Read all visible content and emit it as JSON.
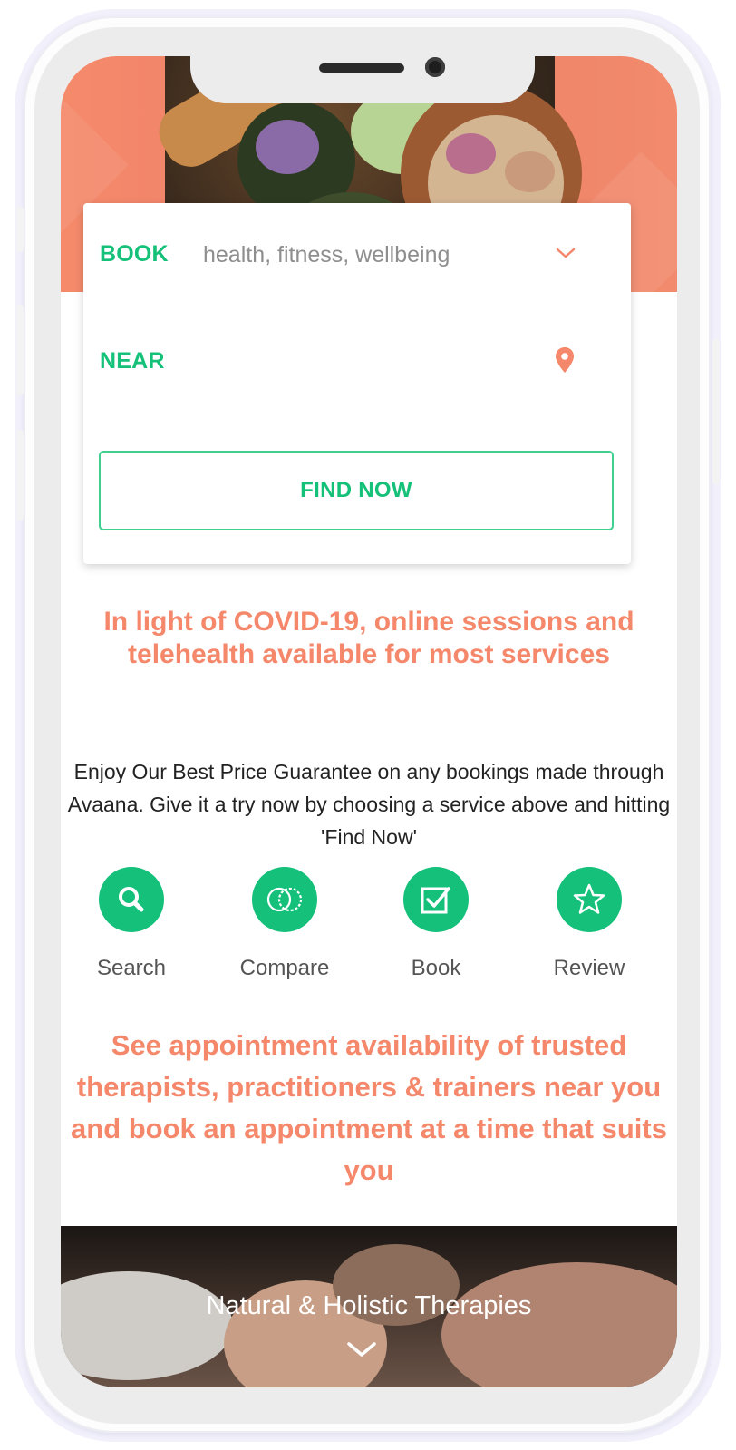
{
  "search": {
    "book_label": "BOOK",
    "book_placeholder": "health, fitness, wellbeing",
    "near_label": "NEAR",
    "near_value": "",
    "find_button": "FIND NOW"
  },
  "notice": "In light of COVID-19, online sessions and telehealth available for most services",
  "guarantee_text": "Enjoy Our Best Price Guarantee on any bookings made through Avaana. Give it a try now by choosing a service above and hitting 'Find Now'",
  "features": [
    {
      "label": "Search",
      "icon": "search-icon"
    },
    {
      "label": "Compare",
      "icon": "compare-icon"
    },
    {
      "label": "Book",
      "icon": "checkbox-icon"
    },
    {
      "label": "Review",
      "icon": "star-icon"
    }
  ],
  "availability_text": "See appointment availability of trusted therapists, practitioners & trainers near you and book an appointment at a time that suits you",
  "category": {
    "title": "Natural & Holistic Therapies"
  },
  "colors": {
    "accent_green": "#15c079",
    "accent_coral": "#f5876b",
    "hero_bg": "#f0826a"
  }
}
